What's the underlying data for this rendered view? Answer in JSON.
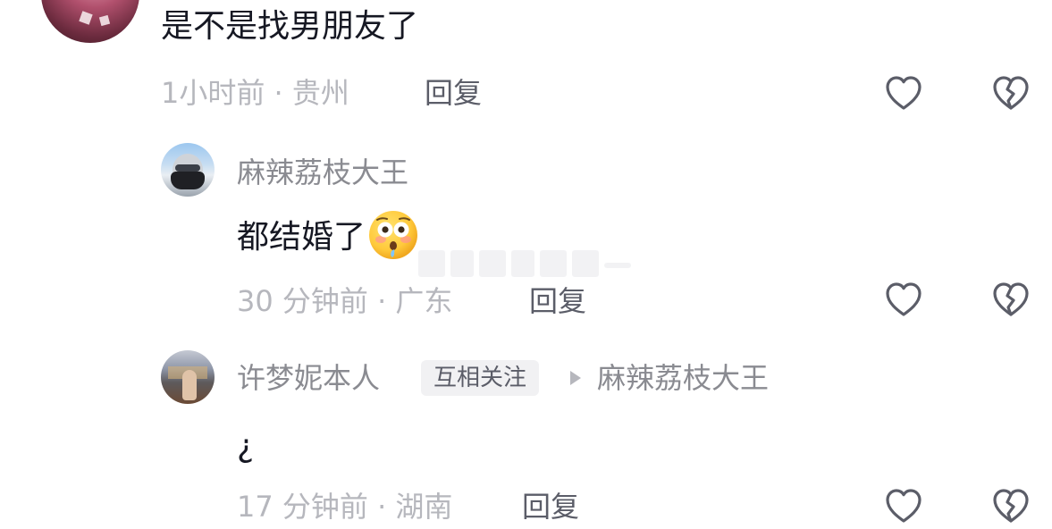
{
  "top_comment": {
    "text": "是不是找男朋友了",
    "meta": "1小时前 · 贵州",
    "reply_label": "回复",
    "like_icon": "heart-outline-icon",
    "dislike_icon": "broken-heart-icon"
  },
  "replies": [
    {
      "username": "麻辣荔枝大王",
      "text": "都结婚了",
      "emoji": "flushed-face-emoji",
      "meta": "30 分钟前 · 广东",
      "reply_label": "回复",
      "like_icon": "heart-outline-icon",
      "dislike_icon": "broken-heart-icon"
    },
    {
      "username": "许梦妮本人",
      "badge": "互相关注",
      "reply_to_arrow": "triangle-right-icon",
      "reply_to": "麻辣荔枝大王",
      "text": "¿",
      "meta": "17 分钟前 · 湖南",
      "reply_label": "回复",
      "like_icon": "heart-outline-icon",
      "dislike_icon": "broken-heart-icon"
    }
  ],
  "colors": {
    "primary_text": "#161823",
    "secondary_text": "#8a8b91",
    "meta_text": "#b6b7bd",
    "reply_text": "#5b5d68",
    "icon_stroke": "#5b5d68",
    "badge_bg": "#f1f1f3"
  }
}
